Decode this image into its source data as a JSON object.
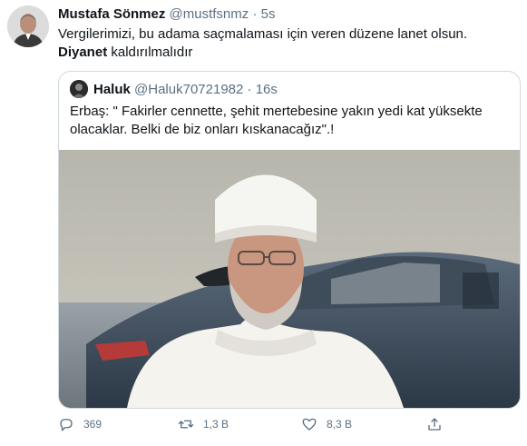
{
  "tweet": {
    "author_name": "Mustafa Sönmez",
    "author_handle": "@mustfsnmz",
    "separator": "·",
    "time": "5s",
    "text_plain": "Vergilerimizi, bu adama saçmalaması için veren düzene lanet olsun. ",
    "text_bold": "Diyanet",
    "text_tail": " kaldırılmalıdır"
  },
  "quote": {
    "author_name": "Haluk",
    "author_handle": "@Haluk70721982",
    "separator": "·",
    "time": "16s",
    "text": "Erbaş: \" Fakirler cennette, şehit mertebesine yakın yedi kat yüksekte olacaklar. Belki de biz onları kıskanacağız\".!"
  },
  "actions": {
    "reply": {
      "icon": "reply-icon",
      "count": "369"
    },
    "retweet": {
      "icon": "retweet-icon",
      "count": "1,3 B"
    },
    "like": {
      "icon": "heart-icon",
      "count": "8,3 B"
    },
    "share": {
      "icon": "share-icon",
      "count": ""
    }
  },
  "colors": {
    "text": "#0f1419",
    "muted": "#5b7083",
    "border": "#cfd9de"
  }
}
